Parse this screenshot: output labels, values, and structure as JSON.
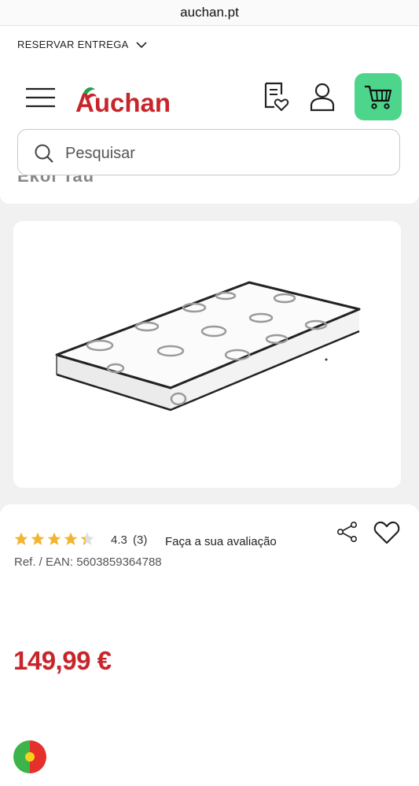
{
  "browser": {
    "url": "auchan.pt"
  },
  "header": {
    "reservar_label": "RESERVAR ENTREGA",
    "logo_text": "Auchan",
    "search_placeholder": "Pesquisar",
    "peek_text": "Ekoi Tau"
  },
  "product": {
    "rating_value": "4.3",
    "rating_count": "(3)",
    "rating_stars": 4.3,
    "review_link": "Faça a sua avaliação",
    "ref": "Ref. / EAN: 5603859364788",
    "price": "149,99 €"
  },
  "colors": {
    "brand_red": "#c8252b",
    "cart_green": "#4cd58b",
    "star_gold": "#f2b531"
  }
}
